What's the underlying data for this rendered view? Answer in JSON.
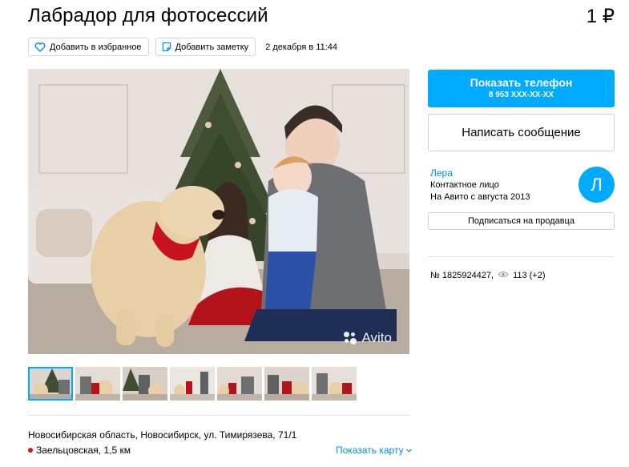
{
  "listing": {
    "title": "Лабрадор для фотосессий",
    "price": "1 ₽",
    "favorite_label": "Добавить в избранное",
    "note_label": "Добавить заметку",
    "date": "2 декабря в 11:44"
  },
  "photo": {
    "watermark": "Avito",
    "thumbnail_count": 7,
    "active_thumbnail": 1
  },
  "location": {
    "address": "Новосибирская область, Новосибирск, ул. Тимирязева, 71/1",
    "metro": "Заельцовская, 1,5 км",
    "show_map": "Показать карту"
  },
  "contact": {
    "phone_button_label": "Показать телефон",
    "phone_masked": "8 953 XXX-XX-XX",
    "message_button_label": "Написать сообщение"
  },
  "seller": {
    "name": "Лера",
    "role": "Контактное лицо",
    "since": "На Авито с августа 2013",
    "avatar_letter": "Л",
    "subscribe_label": "Подписаться на продавца"
  },
  "stats": {
    "ad_number": "№ 1825924427,",
    "views": "113 (+2)"
  },
  "colors": {
    "accent": "#00aaff",
    "link": "#0091d9",
    "metro": "#dd1111"
  }
}
